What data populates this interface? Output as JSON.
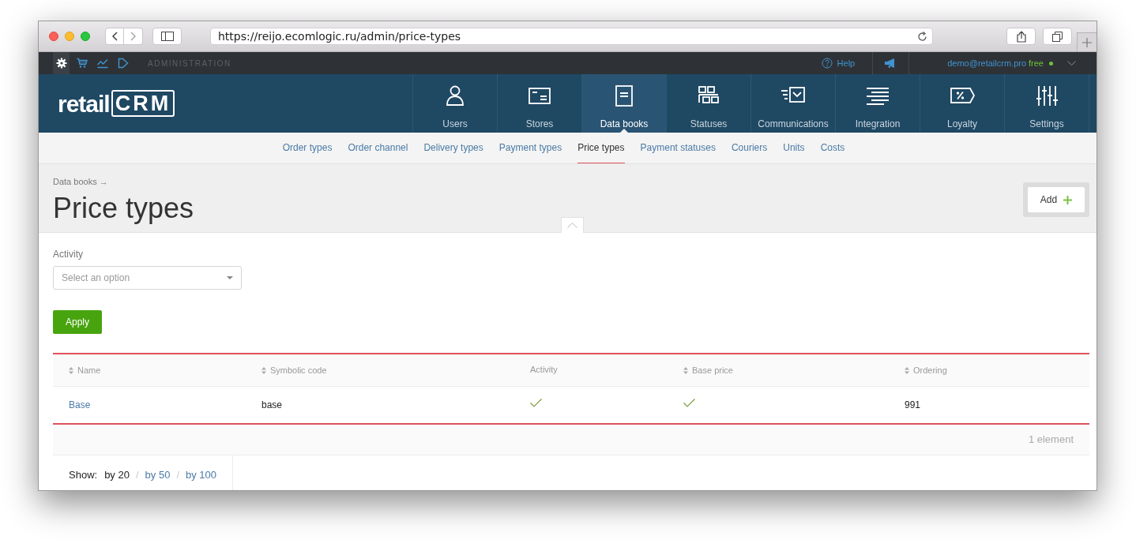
{
  "browser": {
    "url": "https://reijo.ecomlogic.ru/admin/price-types"
  },
  "admin_bar": {
    "sections": [
      {
        "kind": "gear",
        "selected": true
      },
      {
        "kind": "cart",
        "selected": false
      },
      {
        "kind": "chart",
        "selected": false
      },
      {
        "kind": "play",
        "selected": false
      }
    ],
    "title": "ADMINISTRATION",
    "help": "Help",
    "user": "demo@retailcrm.pro",
    "plan": "free"
  },
  "logo": {
    "text": "retail",
    "mark": "CRM"
  },
  "main_nav": [
    {
      "label": "Users",
      "kind": "users",
      "selected": false
    },
    {
      "label": "Stores",
      "kind": "stores",
      "selected": false
    },
    {
      "label": "Data books",
      "kind": "books",
      "selected": true
    },
    {
      "label": "Statuses",
      "kind": "statuses",
      "selected": false
    },
    {
      "label": "Communications",
      "kind": "communications",
      "selected": false
    },
    {
      "label": "Integration",
      "kind": "integration",
      "selected": false
    },
    {
      "label": "Loyalty",
      "kind": "loyalty",
      "selected": false
    },
    {
      "label": "Settings",
      "kind": "settings",
      "selected": false
    }
  ],
  "sub_nav": [
    {
      "label": "Order types",
      "selected": false
    },
    {
      "label": "Order channel",
      "selected": false
    },
    {
      "label": "Delivery types",
      "selected": false
    },
    {
      "label": "Payment types",
      "selected": false
    },
    {
      "label": "Price types",
      "selected": true
    },
    {
      "label": "Payment statuses",
      "selected": false
    },
    {
      "label": "Couriers",
      "selected": false
    },
    {
      "label": "Units",
      "selected": false
    },
    {
      "label": "Costs",
      "selected": false
    }
  ],
  "breadcrumb": "Data books →",
  "title": "Price types",
  "add_button": "Add",
  "filter": {
    "label": "Activity",
    "placeholder": "Select an option",
    "apply": "Apply"
  },
  "table": {
    "columns": [
      {
        "label": "Name",
        "sortable": true
      },
      {
        "label": "Symbolic code",
        "sortable": true
      },
      {
        "label": "Activity",
        "sortable": false
      },
      {
        "label": "Base price",
        "sortable": true
      },
      {
        "label": "Ordering",
        "sortable": true
      }
    ],
    "rows": [
      {
        "cells": [
          {
            "kind": "link",
            "text": "Base"
          },
          {
            "kind": "text",
            "text": "base"
          },
          {
            "kind": "check",
            "checked": true
          },
          {
            "kind": "check",
            "checked": true
          },
          {
            "kind": "text",
            "text": "991"
          }
        ]
      }
    ]
  },
  "footer": {
    "count": "1 element",
    "show_label": "Show:",
    "separator": "/",
    "page_sizes": [
      {
        "label": "by 20",
        "selected": true
      },
      {
        "label": "by 50",
        "selected": false
      },
      {
        "label": "by 100",
        "selected": false
      }
    ]
  }
}
